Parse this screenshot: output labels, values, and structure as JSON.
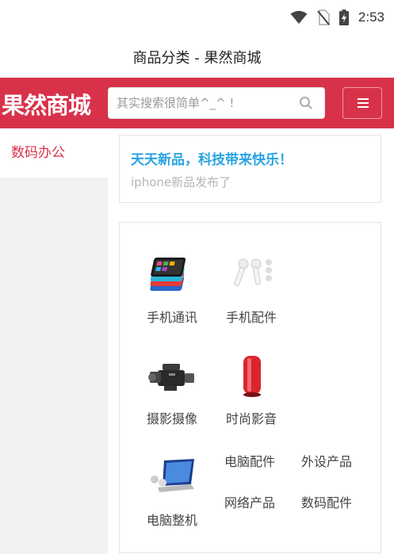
{
  "status_bar": {
    "time": "2:53",
    "icons": [
      "wifi-icon",
      "no-sim-icon",
      "battery-charging-icon"
    ]
  },
  "title": "商品分类 - 果然商城",
  "header": {
    "logo": "果然商城",
    "search": {
      "placeholder": "其实搜索很简单^_^ !"
    },
    "menu_icon": "menu-icon",
    "colors": {
      "brand": "#d8324a"
    }
  },
  "sidebar": {
    "items": [
      {
        "label": "数码办公",
        "active": true
      }
    ]
  },
  "promo": {
    "title": "天天新品，科技带来快乐！",
    "subtitle": "iphone新品发布了",
    "title_color": "#29a3e3"
  },
  "categories": [
    {
      "label": "手机通讯",
      "icon": "phones-icon"
    },
    {
      "label": "手机配件",
      "icon": "earphones-icon"
    },
    {
      "label": "摄影摄像",
      "icon": "camcorder-icon"
    },
    {
      "label": "时尚影音",
      "icon": "speaker-icon"
    },
    {
      "label": "电脑整机",
      "icon": "laptop-icon"
    }
  ],
  "links": [
    "电脑配件",
    "外设产品",
    "网络产品",
    "数码配件"
  ]
}
